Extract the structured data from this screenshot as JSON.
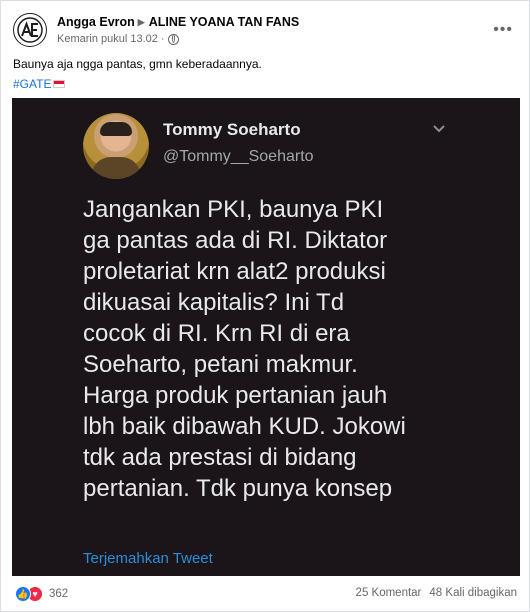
{
  "post": {
    "author": "Angga Evron",
    "group": "ALINE YOANA TAN FANS",
    "timestamp": "Kemarin pukul 13.02",
    "privacy_icon": "globe-icon",
    "text": "Baunya aja ngga pantas, gmn keberadaannya.",
    "hashtag": "#GATE",
    "menu_icon": "more-icon"
  },
  "tweet": {
    "name": "Tommy Soeharto",
    "handle": "@Tommy__Soeharto",
    "lines": [
      "Jangankan PKI, baunya PKI",
      "ga pantas ada di RI. Diktator",
      "proletariat krn alat2 produksi",
      "dikuasai kapitalis? Ini Td",
      "cocok di RI. Krn RI di era",
      "Soeharto, petani makmur.",
      "Harga produk pertanian jauh",
      "lbh baik dibawah KUD. Jokowi",
      "tdk ada prestasi di bidang",
      "pertanian. Tdk punya konsep"
    ],
    "translate": "Terjemahkan Tweet"
  },
  "footer": {
    "reaction_count": "362",
    "comments": "25 Komentar",
    "shares": "48 Kali dibagikan"
  },
  "colors": {
    "hashtag": "#216fdb",
    "tweet_bg": "#1b1419",
    "translate_link": "#2a8fd8",
    "like": "#1877f2",
    "love": "#f02849"
  }
}
